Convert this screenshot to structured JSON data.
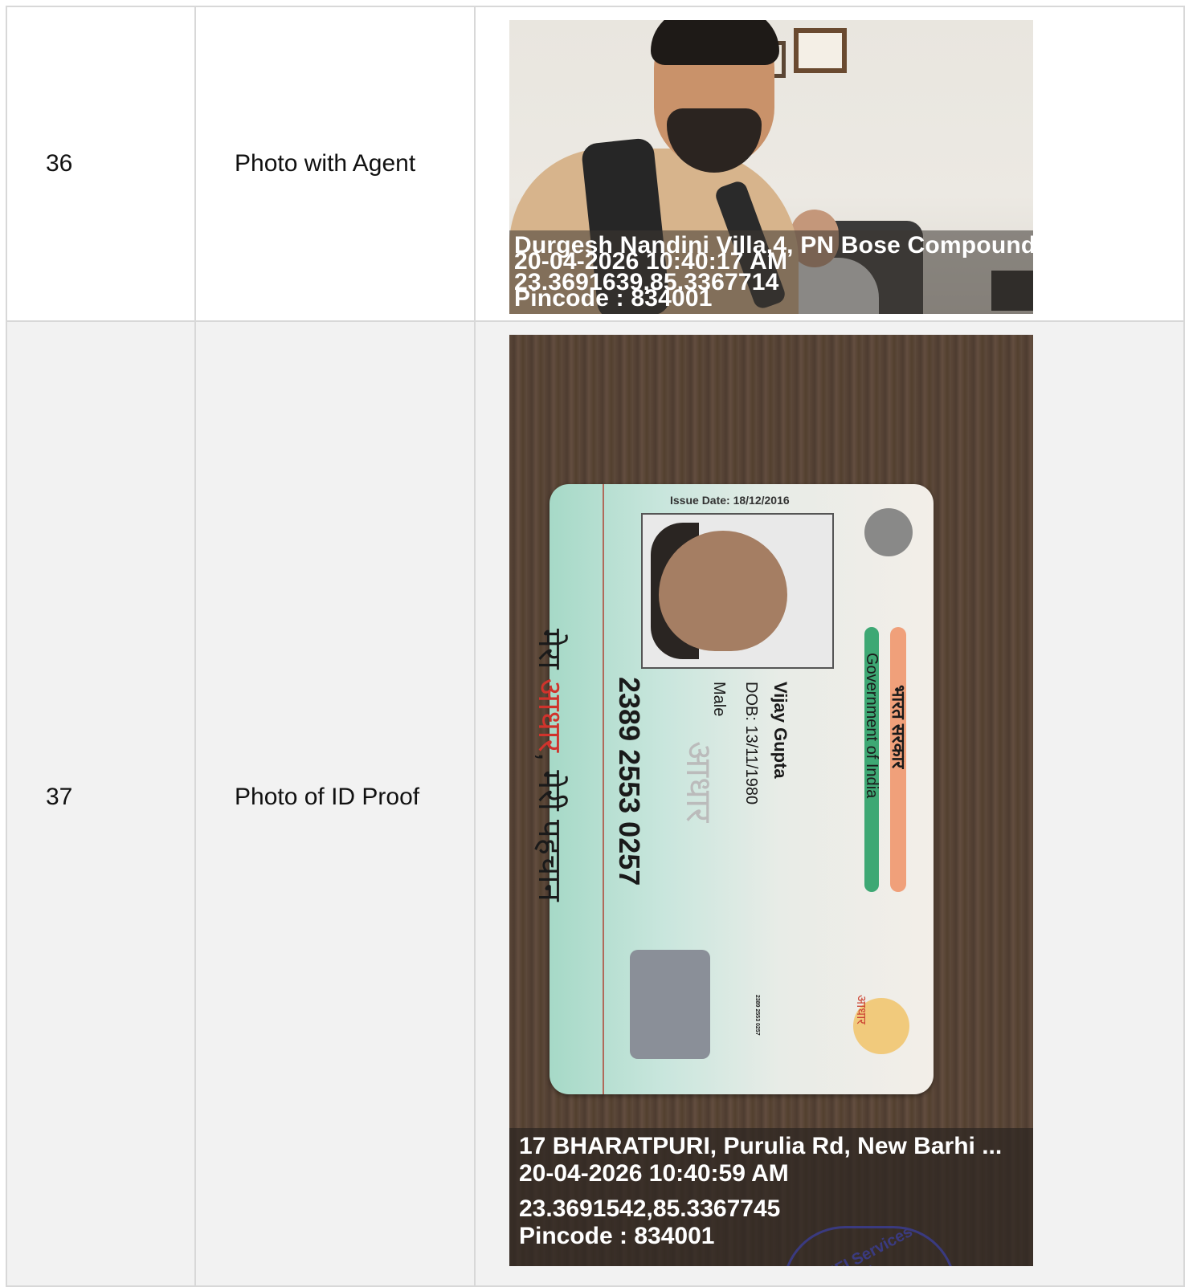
{
  "rows": [
    {
      "no": "36",
      "label": "Photo with Agent",
      "overlay": {
        "address": "Durgesh Nandini Villa,4, PN Bose Compound",
        "datetime": "20-04-2026 10:40:17 AM",
        "coords": "23.3691639,85.3367714",
        "pincode": "Pincode : 834001"
      }
    },
    {
      "no": "37",
      "label": "Photo of ID Proof",
      "card": {
        "issue_date": "Issue Date: 18/12/2016",
        "name": "Vijay Gupta",
        "dob": "DOB: 13/11/1980",
        "gender": "Male",
        "number": "2389 2553 0257",
        "small_number": "2389 2553 0257",
        "hindi_gov": "भारत सरकार",
        "gov": "Government of India",
        "slogan_a": "मेरा ",
        "slogan_b": "आधार",
        "slogan_c": ", मेरी पहचान",
        "aadhaar_watermark": "आधार",
        "aadhaar_logo_text": "आधार"
      },
      "overlay": {
        "address": "17 BHARATPURI, Purulia Rd, New Barhi ...",
        "datetime": "20-04-2026 10:40:59 AM",
        "coords": "23.3691542,85.3367745",
        "pincode": "Pincode : 834001"
      },
      "stamp_text": "BNFI Services Limited"
    }
  ],
  "colors": {
    "border": "#d8d8d8",
    "row_alt_bg": "#f2f2f2",
    "slogan_red": "#d0332c"
  }
}
